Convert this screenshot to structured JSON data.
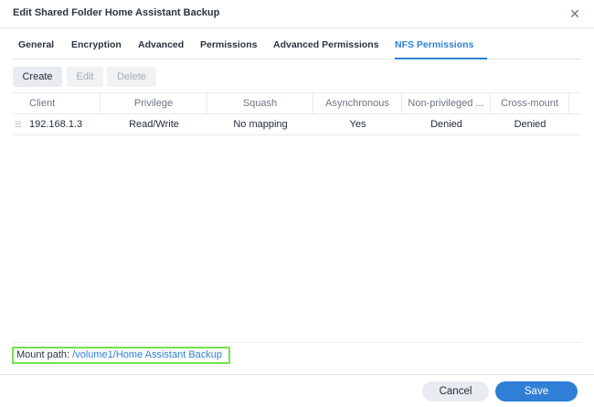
{
  "dialog": {
    "title": "Edit Shared Folder Home Assistant Backup",
    "close_icon": "close-icon"
  },
  "tabs": [
    {
      "label": "General",
      "active": false
    },
    {
      "label": "Encryption",
      "active": false
    },
    {
      "label": "Advanced",
      "active": false
    },
    {
      "label": "Permissions",
      "active": false
    },
    {
      "label": "Advanced Permissions",
      "active": false
    },
    {
      "label": "NFS Permissions",
      "active": true
    }
  ],
  "toolbar": {
    "create_label": "Create",
    "edit_label": "Edit",
    "delete_label": "Delete"
  },
  "table": {
    "columns": [
      "Client",
      "Privilege",
      "Squash",
      "Asynchronous",
      "Non-privileged ...",
      "Cross-mount"
    ],
    "rows": [
      {
        "client": "192.168.1.3",
        "privilege": "Read/Write",
        "squash": "No mapping",
        "asynchronous": "Yes",
        "non_privileged": "Denied",
        "cross_mount": "Denied"
      }
    ]
  },
  "mount": {
    "label": "Mount path:",
    "path": "/volume1/Home Assistant Backup"
  },
  "footer": {
    "cancel_label": "Cancel",
    "save_label": "Save"
  },
  "colors": {
    "accent": "#2f7fd6",
    "highlight": "#74e34d"
  }
}
